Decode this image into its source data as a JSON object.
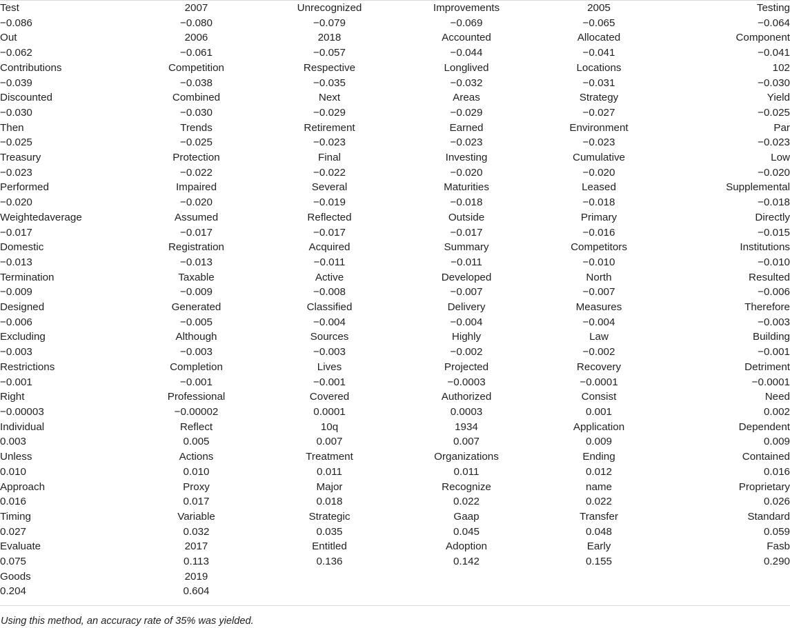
{
  "table": {
    "columns": 6,
    "alignments": [
      "left",
      "center",
      "center",
      "center",
      "center",
      "right"
    ],
    "rows": [
      [
        "Test",
        "2007",
        "Unrecognized",
        "Improvements",
        "2005",
        "Testing"
      ],
      [
        "−0.086",
        "−0.080",
        "−0.079",
        "−0.069",
        "−0.065",
        "−0.064"
      ],
      [
        "Out",
        "2006",
        "2018",
        "Accounted",
        "Allocated",
        "Component"
      ],
      [
        "−0.062",
        "−0.061",
        "−0.057",
        "−0.044",
        "−0.041",
        "−0.041"
      ],
      [
        "Contributions",
        "Competition",
        "Respective",
        "Longlived",
        "Locations",
        "102"
      ],
      [
        "−0.039",
        "−0.038",
        "−0.035",
        "−0.032",
        "−0.031",
        "−0.030"
      ],
      [
        "Discounted",
        "Combined",
        "Next",
        "Areas",
        "Strategy",
        "Yield"
      ],
      [
        "−0.030",
        "−0.030",
        "−0.029",
        "−0.029",
        "−0.027",
        "−0.025"
      ],
      [
        "Then",
        "Trends",
        "Retirement",
        "Earned",
        "Environment",
        "Par"
      ],
      [
        "−0.025",
        "−0.025",
        "−0.023",
        "−0.023",
        "−0.023",
        "−0.023"
      ],
      [
        "Treasury",
        "Protection",
        "Final",
        "Investing",
        "Cumulative",
        "Low"
      ],
      [
        "−0.023",
        "−0.022",
        "−0.022",
        "−0.020",
        "−0.020",
        "−0.020"
      ],
      [
        "Performed",
        "Impaired",
        "Several",
        "Maturities",
        "Leased",
        "Supplemental"
      ],
      [
        "−0.020",
        "−0.020",
        "−0.019",
        "−0.018",
        "−0.018",
        "−0.018"
      ],
      [
        "Weightedaverage",
        "Assumed",
        "Reflected",
        "Outside",
        "Primary",
        "Directly"
      ],
      [
        "−0.017",
        "−0.017",
        "−0.017",
        "−0.017",
        "−0.016",
        "−0.015"
      ],
      [
        "Domestic",
        "Registration",
        "Acquired",
        "Summary",
        "Competitors",
        "Institutions"
      ],
      [
        "−0.013",
        "−0.013",
        "−0.011",
        "−0.011",
        "−0.010",
        "−0.010"
      ],
      [
        "Termination",
        "Taxable",
        "Active",
        "Developed",
        "North",
        "Resulted"
      ],
      [
        "−0.009",
        "−0.009",
        "−0.008",
        "−0.007",
        "−0.007",
        "−0.006"
      ],
      [
        "Designed",
        "Generated",
        "Classified",
        "Delivery",
        "Measures",
        "Therefore"
      ],
      [
        "−0.006",
        "−0.005",
        "−0.004",
        "−0.004",
        "−0.004",
        "−0.003"
      ],
      [
        "Excluding",
        "Although",
        "Sources",
        "Highly",
        "Law",
        "Building"
      ],
      [
        "−0.003",
        "−0.003",
        "−0.003",
        "−0.002",
        "−0.002",
        "−0.001"
      ],
      [
        "Restrictions",
        "Completion",
        "Lives",
        "Projected",
        "Recovery",
        "Detriment"
      ],
      [
        "−0.001",
        "−0.001",
        "−0.001",
        "−0.0003",
        "−0.0001",
        "−0.0001"
      ],
      [
        "Right",
        "Professional",
        "Covered",
        "Authorized",
        "Consist",
        "Need"
      ],
      [
        "−0.00003",
        "−0.00002",
        "0.0001",
        "0.0003",
        "0.001",
        "0.002"
      ],
      [
        "Individual",
        "Reflect",
        "10q",
        "1934",
        "Application",
        "Dependent"
      ],
      [
        "0.003",
        "0.005",
        "0.007",
        "0.007",
        "0.009",
        "0.009"
      ],
      [
        "Unless",
        "Actions",
        "Treatment",
        "Organizations",
        "Ending",
        "Contained"
      ],
      [
        "0.010",
        "0.010",
        "0.011",
        "0.011",
        "0.012",
        "0.016"
      ],
      [
        "Approach",
        "Proxy",
        "Major",
        "Recognize",
        "name",
        "Proprietary"
      ],
      [
        "0.016",
        "0.017",
        "0.018",
        "0.022",
        "0.022",
        "0.026"
      ],
      [
        "Timing",
        "Variable",
        "Strategic",
        "Gaap",
        "Transfer",
        "Standard"
      ],
      [
        "0.027",
        "0.032",
        "0.035",
        "0.045",
        "0.048",
        "0.059"
      ],
      [
        "Evaluate",
        "2017",
        "Entitled",
        "Adoption",
        "Early",
        "Fasb"
      ],
      [
        "0.075",
        "0.113",
        "0.136",
        "0.142",
        "0.155",
        "0.290"
      ],
      [
        "Goods",
        "2019",
        "",
        "",
        "",
        ""
      ],
      [
        "0.204",
        "0.604",
        "",
        "",
        "",
        ""
      ]
    ]
  },
  "footnote": {
    "text": "Using this method, an accuracy rate of 35% was yielded."
  },
  "colors": {
    "text": "#222222",
    "rule": "#d9d9d9",
    "background": "#ffffff"
  }
}
